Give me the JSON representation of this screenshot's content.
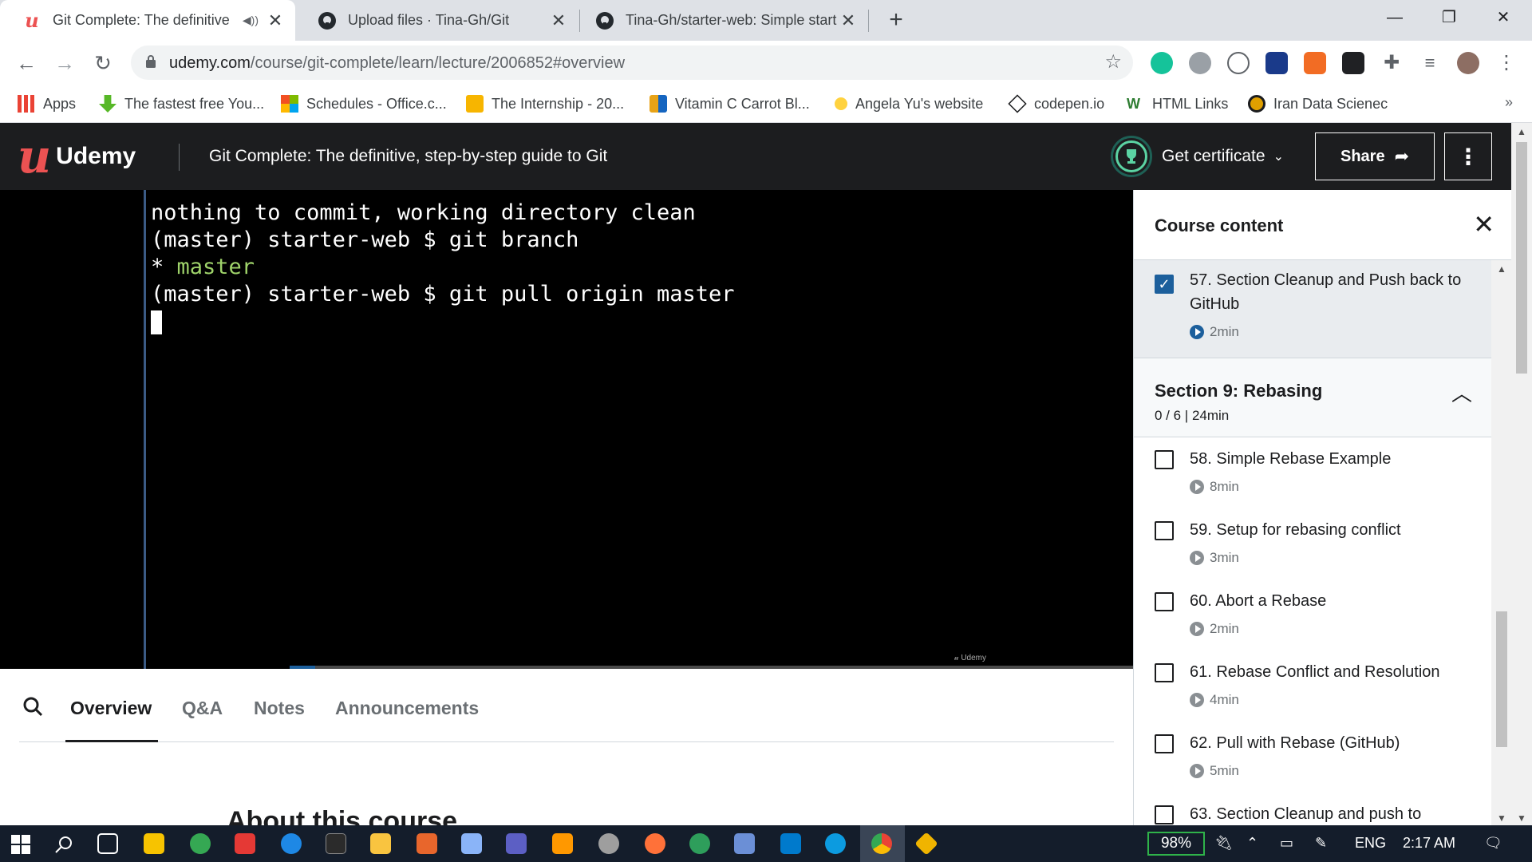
{
  "browser": {
    "tabs": [
      {
        "title": "Git Complete: The definitive",
        "active": true,
        "icon": "udemy-icon",
        "muted_icon": "speaker-icon"
      },
      {
        "title": "Upload files · Tina-Gh/Git",
        "active": false,
        "icon": "github-icon"
      },
      {
        "title": "Tina-Gh/starter-web: Simple start",
        "active": false,
        "icon": "github-icon"
      }
    ],
    "new_tab": "+",
    "url_host": "udemy.com",
    "url_path": "/course/git-complete/learn/lecture/2006852#overview",
    "bookmarks": [
      {
        "label": "Apps",
        "icon": "apps-grid-icon",
        "color": "#ea4335"
      },
      {
        "label": "The fastest free You...",
        "icon": "download-arrow-icon",
        "color": "#57b827"
      },
      {
        "label": "Schedules - Office.c...",
        "icon": "microsoft-icon",
        "color": "#f25022"
      },
      {
        "label": "The Internship - 20...",
        "icon": "message-icon",
        "color": "#f7b500"
      },
      {
        "label": "Vitamin C Carrot Bl...",
        "icon": "bag-icon",
        "color": "#e8a317"
      },
      {
        "label": "Angela Yu's website",
        "icon": "site-icon",
        "color": "#ffd23f"
      },
      {
        "label": "codepen.io",
        "icon": "codepen-icon",
        "color": "#1c1d1f"
      },
      {
        "label": "HTML Links",
        "icon": "w-icon",
        "color": "#2e7d32"
      },
      {
        "label": "Iran Data Scienec",
        "icon": "circle-logo-icon",
        "color": "#e0a000"
      }
    ],
    "bookmarks_more": "»"
  },
  "udemy": {
    "logo_letter": "u",
    "logo_word": "Udemy",
    "course_title": "Git Complete: The definitive, step-by-step guide to Git",
    "certificate_label": "Get certificate",
    "share_label": "Share",
    "brand_red": "#ec5252"
  },
  "terminal": {
    "line1": "nothing to commit, working directory clean",
    "line2": "(master) starter-web $ git branch",
    "line3_star": "* ",
    "line3_branch": "master",
    "line4": "(master) starter-web $ git pull origin master",
    "watermark": "Udemy",
    "progress_fraction": 0.03
  },
  "below_video": {
    "tabs": [
      "Overview",
      "Q&A",
      "Notes",
      "Announcements"
    ],
    "active_tab": "Overview",
    "about_heading": "About this course"
  },
  "sidebar": {
    "title": "Course content",
    "current": {
      "label": "57. Section Cleanup and Push back to GitHub",
      "duration": "2min",
      "completed": true
    },
    "section": {
      "title": "Section 9: Rebasing",
      "subtitle": "0 / 6 | 24min"
    },
    "lectures": [
      {
        "label": "58. Simple Rebase Example",
        "duration": "8min"
      },
      {
        "label": "59. Setup for rebasing conflict",
        "duration": "3min"
      },
      {
        "label": "60. Abort a Rebase",
        "duration": "2min"
      },
      {
        "label": "61. Rebase Conflict and Resolution",
        "duration": "4min"
      },
      {
        "label": "62. Pull with Rebase (GitHub)",
        "duration": "5min"
      },
      {
        "label": "63. Section Cleanup and push to",
        "duration": ""
      }
    ]
  },
  "taskbar": {
    "battery": "98%",
    "language": "ENG",
    "time": "2:17 AM"
  }
}
